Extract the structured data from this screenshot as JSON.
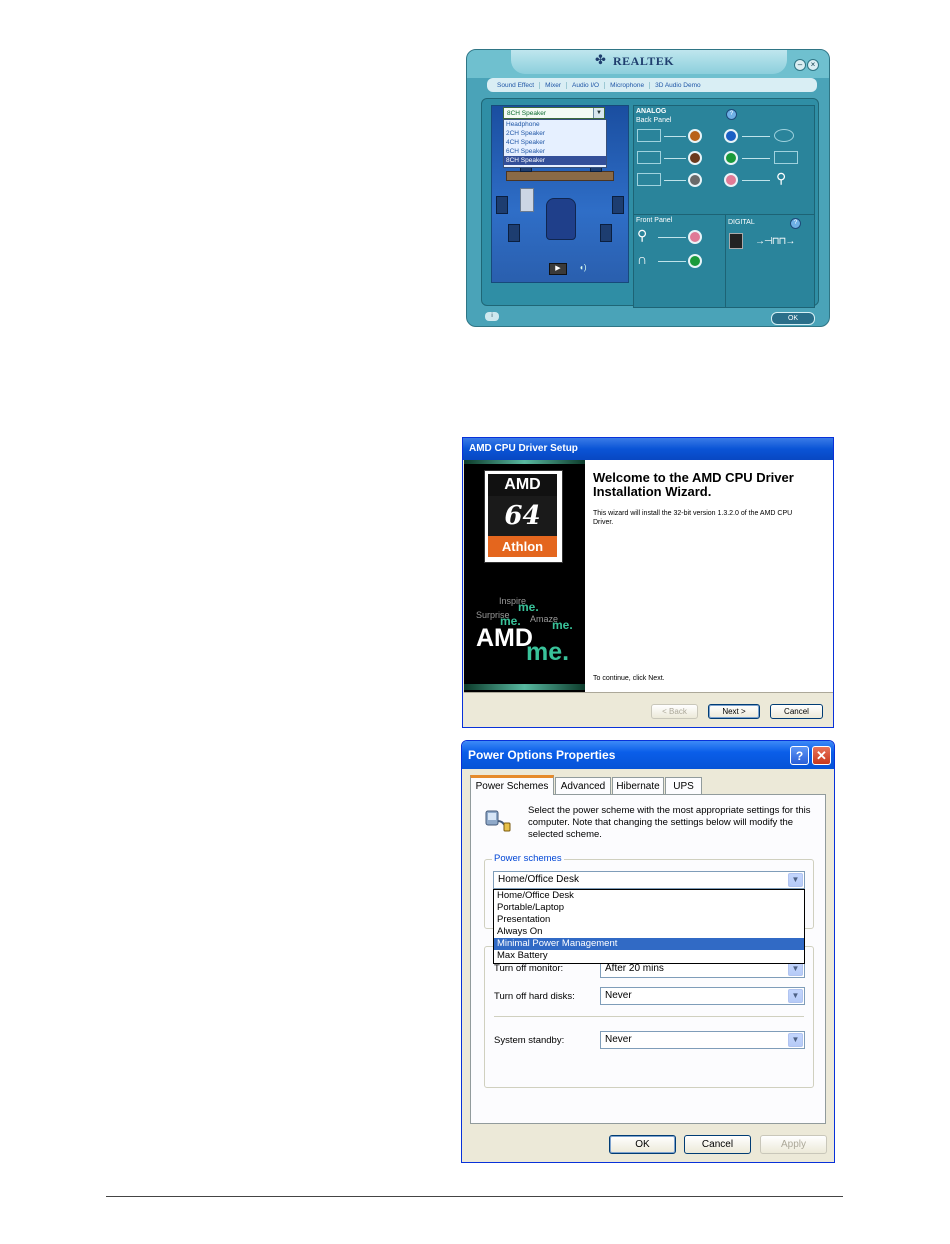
{
  "realtek": {
    "logo": "REALTEK",
    "tabs": [
      "Sound Effect",
      "Mixer",
      "Audio I/O",
      "Microphone",
      "3D Audio Demo"
    ],
    "speaker_select": "8CH Speaker",
    "speaker_options": [
      "Headphone",
      "2CH Speaker",
      "4CH Speaker",
      "6CH Speaker",
      "8CH Speaker"
    ],
    "speaker_selected_index": 4,
    "analog_label": "ANALOG",
    "back_panel_label": "Back Panel",
    "front_panel_label": "Front Panel",
    "digital_label": "DIGITAL",
    "ok_label": "OK",
    "jack_colors": {
      "orange": "#b8621a",
      "blue": "#1b5fc4",
      "brown": "#6b3a1e",
      "green": "#1a9a3a",
      "gray": "#6a6a6a",
      "pink": "#e07a96"
    }
  },
  "amd_wizard": {
    "title": "AMD CPU Driver Setup",
    "heading": "Welcome to the AMD CPU Driver Installation Wizard.",
    "description": "This wizard will install the 32-bit version 1.3.2.0 of the AMD CPU Driver.",
    "continue_text": "To continue, click Next.",
    "logo": {
      "brand": "AMD",
      "model": "64",
      "name": "Athlon"
    },
    "tagline": {
      "inspire": "Inspire",
      "surprise": "Surprise",
      "amaze": "Amaze",
      "me": "me.",
      "big_brand": "AMD",
      "big_me": "me."
    },
    "buttons": {
      "back": "< Back",
      "next": "Next >",
      "cancel": "Cancel"
    }
  },
  "power_options": {
    "title": "Power Options Properties",
    "tabs": [
      "Power Schemes",
      "Advanced",
      "Hibernate",
      "UPS"
    ],
    "active_tab": "Power Schemes",
    "description": "Select the power scheme with the most appropriate settings for this computer. Note that changing the settings below will modify the selected scheme.",
    "schemes_label": "Power schemes",
    "scheme_value": "Home/Office Desk",
    "scheme_options": [
      "Home/Office Desk",
      "Portable/Laptop",
      "Presentation",
      "Always On",
      "Minimal Power Management",
      "Max Battery"
    ],
    "scheme_highlighted_index": 4,
    "settings": [
      {
        "label": "Turn off monitor:",
        "value": "After 20 mins"
      },
      {
        "label": "Turn off hard disks:",
        "value": "Never"
      },
      {
        "label": "System standby:",
        "value": "Never"
      }
    ],
    "buttons": {
      "ok": "OK",
      "cancel": "Cancel",
      "apply": "Apply"
    },
    "help_glyph": "?",
    "close_glyph": "✕"
  }
}
